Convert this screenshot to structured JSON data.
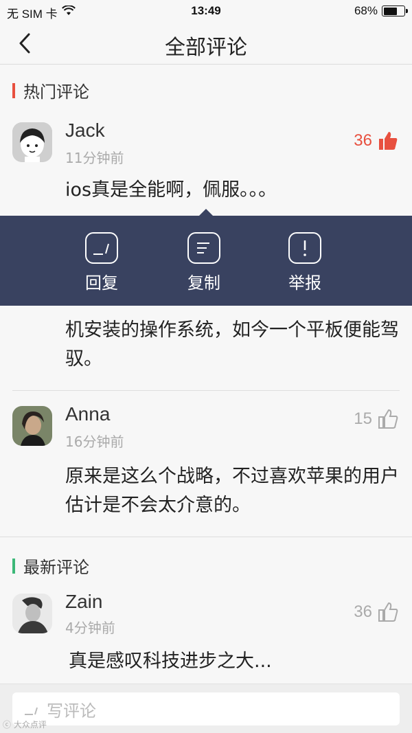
{
  "status_bar": {
    "carrier": "无 SIM 卡",
    "time": "13:49",
    "battery_percent": "68%",
    "battery_level": 0.68
  },
  "nav": {
    "title": "全部评论"
  },
  "hot_section": {
    "title": "热门评论",
    "accent": "#e8503f"
  },
  "new_section": {
    "title": "最新评论",
    "accent": "#3cb878"
  },
  "comments": [
    {
      "user": "Jack",
      "time": "11分钟前",
      "likes": "36",
      "liked": true,
      "text": "ios真是全能啊，佩服。。。"
    },
    {
      "text_partial": "机安装的操作系统，如今一个平板便能驾驭。"
    },
    {
      "user": "Anna",
      "time": "16分钟前",
      "likes": "15",
      "liked": false,
      "text": "原来是这么个战略，不过喜欢苹果的用户估计是不会太介意的。"
    },
    {
      "user": "Zain",
      "time": "4分钟前",
      "likes": "36",
      "liked": false,
      "text": "真是感叹科技进步之大..."
    }
  ],
  "popup": {
    "reply": "回复",
    "copy": "复制",
    "report": "举报",
    "background": "#394260"
  },
  "bottom": {
    "placeholder": "写评论",
    "watermark": "大众点评"
  },
  "colors": {
    "like_active": "#e8503f",
    "like_inactive": "#aaaaaa"
  }
}
